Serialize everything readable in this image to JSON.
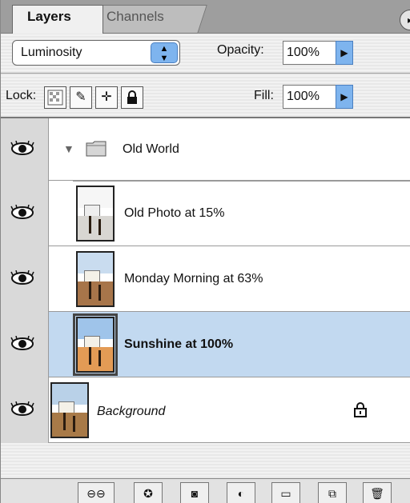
{
  "tabs": [
    {
      "label": "Layers"
    },
    {
      "label": "Channels"
    }
  ],
  "blend": {
    "mode": "Luminosity",
    "opacity_label": "Opacity:",
    "opacity_value": "100%"
  },
  "lock_row": {
    "lock_label": "Lock:",
    "fill_label": "Fill:",
    "fill_value": "100%"
  },
  "layers": [
    {
      "name": "Old World",
      "kind": "group",
      "expanded": true
    },
    {
      "name": "Old Photo at 15%",
      "kind": "layer"
    },
    {
      "name": "Monday Morning at 63%",
      "kind": "layer"
    },
    {
      "name": "Sunshine at 100%",
      "kind": "layer",
      "selected": true
    },
    {
      "name": "Background",
      "kind": "background",
      "locked": true
    }
  ],
  "colors": {
    "selection": "#c2d9f0",
    "accent_button": "#7eb4ee"
  },
  "icons": {
    "panel_menu": "panel-menu-icon",
    "eye": "eye-icon",
    "folder": "folder-icon",
    "lock": "lock-icon"
  }
}
